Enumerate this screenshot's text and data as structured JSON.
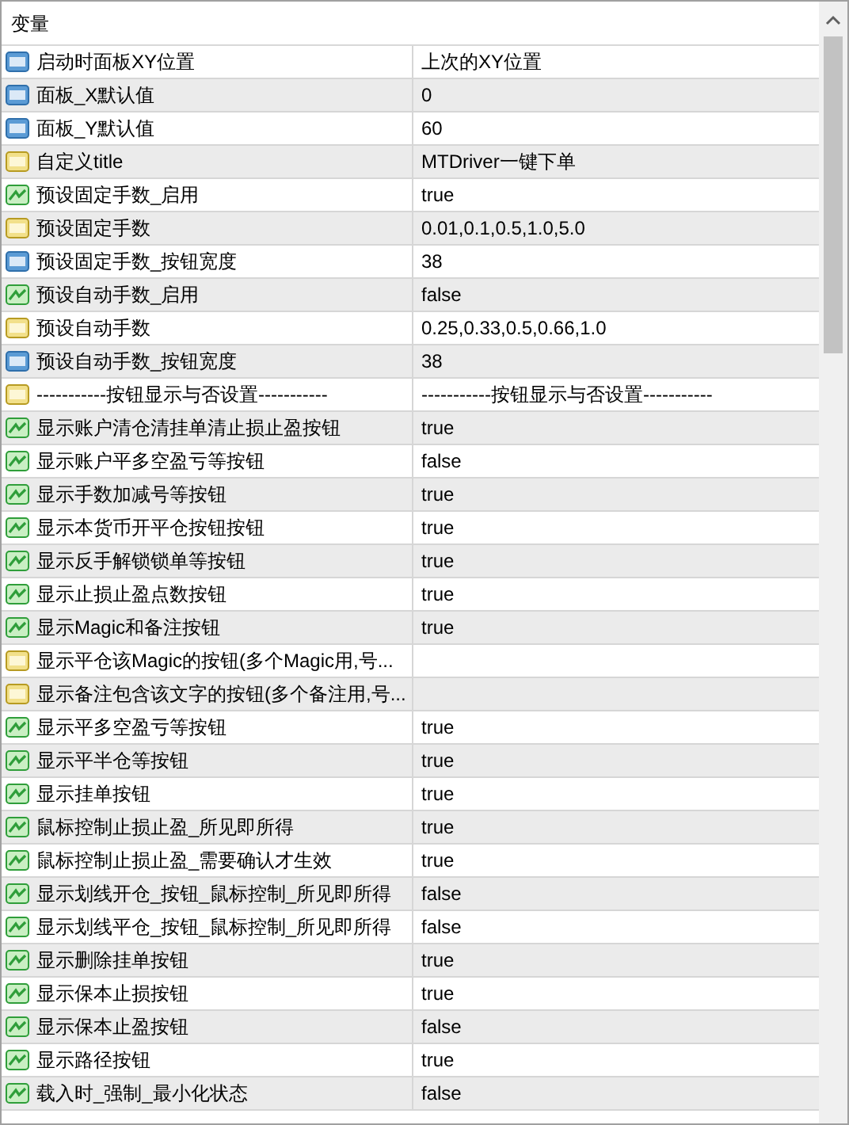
{
  "header": {
    "column_1": "变量"
  },
  "rows": [
    {
      "kind": "int",
      "name": "启动时面板XY位置",
      "value": "上次的XY位置"
    },
    {
      "kind": "int",
      "name": "面板_X默认值",
      "value": "0"
    },
    {
      "kind": "int",
      "name": "面板_Y默认值",
      "value": "60"
    },
    {
      "kind": "string",
      "name": "自定义title",
      "value": "MTDriver一键下单"
    },
    {
      "kind": "bool",
      "name": "预设固定手数_启用",
      "value": "true"
    },
    {
      "kind": "string",
      "name": "预设固定手数",
      "value": "0.01,0.1,0.5,1.0,5.0"
    },
    {
      "kind": "int",
      "name": "预设固定手数_按钮宽度",
      "value": "38"
    },
    {
      "kind": "bool",
      "name": "预设自动手数_启用",
      "value": "false"
    },
    {
      "kind": "string",
      "name": "预设自动手数",
      "value": "0.25,0.33,0.5,0.66,1.0"
    },
    {
      "kind": "int",
      "name": "预设自动手数_按钮宽度",
      "value": "38"
    },
    {
      "kind": "string",
      "name": "-----------按钮显示与否设置-----------",
      "value": "-----------按钮显示与否设置-----------"
    },
    {
      "kind": "bool",
      "name": "显示账户清仓清挂单清止损止盈按钮",
      "value": "true"
    },
    {
      "kind": "bool",
      "name": "显示账户平多空盈亏等按钮",
      "value": "false"
    },
    {
      "kind": "bool",
      "name": "显示手数加减号等按钮",
      "value": "true"
    },
    {
      "kind": "bool",
      "name": "显示本货币开平仓按钮按钮",
      "value": "true"
    },
    {
      "kind": "bool",
      "name": "显示反手解锁锁单等按钮",
      "value": "true"
    },
    {
      "kind": "bool",
      "name": "显示止损止盈点数按钮",
      "value": "true"
    },
    {
      "kind": "bool",
      "name": "显示Magic和备注按钮",
      "value": "true"
    },
    {
      "kind": "string",
      "name": "显示平仓该Magic的按钮(多个Magic用,号..."
    },
    {
      "kind": "string",
      "name": "显示备注包含该文字的按钮(多个备注用,号..."
    },
    {
      "kind": "bool",
      "name": "显示平多空盈亏等按钮",
      "value": "true"
    },
    {
      "kind": "bool",
      "name": "显示平半仓等按钮",
      "value": "true"
    },
    {
      "kind": "bool",
      "name": "显示挂单按钮",
      "value": "true"
    },
    {
      "kind": "bool",
      "name": "鼠标控制止损止盈_所见即所得",
      "value": "true"
    },
    {
      "kind": "bool",
      "name": "鼠标控制止损止盈_需要确认才生效",
      "value": "true"
    },
    {
      "kind": "bool",
      "name": "显示划线开仓_按钮_鼠标控制_所见即所得",
      "value": "false"
    },
    {
      "kind": "bool",
      "name": "显示划线平仓_按钮_鼠标控制_所见即所得",
      "value": "false"
    },
    {
      "kind": "bool",
      "name": "显示删除挂单按钮",
      "value": "true"
    },
    {
      "kind": "bool",
      "name": "显示保本止损按钮",
      "value": "true"
    },
    {
      "kind": "bool",
      "name": "显示保本止盈按钮",
      "value": "false"
    },
    {
      "kind": "bool",
      "name": "显示路径按钮",
      "value": "true"
    },
    {
      "kind": "bool",
      "name": "载入时_强制_最小化状态",
      "value": "false"
    }
  ]
}
